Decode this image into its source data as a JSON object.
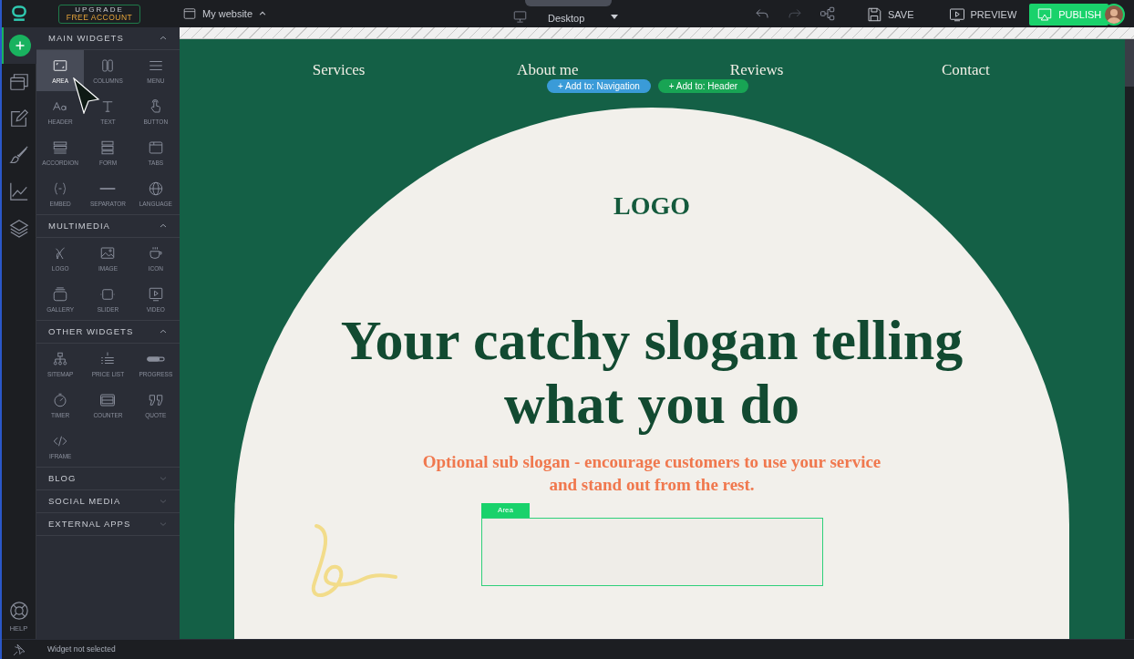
{
  "topbar": {
    "upgrade_top": "UPGRADE",
    "upgrade_bottom": "FREE ACCOUNT",
    "site": "My website",
    "device": "Desktop",
    "buttons": [
      {
        "label": "SAVE",
        "kind": "save"
      },
      {
        "label": "PREVIEW",
        "kind": "preview"
      },
      {
        "label": "PUBLISH",
        "kind": "publish"
      }
    ]
  },
  "rail": {
    "items": [
      {
        "kind": "add",
        "selected": true
      },
      {
        "kind": "pages",
        "selected": false
      },
      {
        "kind": "edit",
        "selected": false
      },
      {
        "kind": "design",
        "selected": false
      },
      {
        "kind": "stats",
        "selected": false
      },
      {
        "kind": "layers",
        "selected": false
      }
    ],
    "help": "HELP"
  },
  "panel": {
    "sections": [
      {
        "title": "MAIN WIDGETS",
        "expanded": true,
        "widgets": [
          {
            "label": "AREA",
            "kind": "area",
            "selected": true
          },
          {
            "label": "COLUMNS",
            "kind": "columns",
            "selected": false
          },
          {
            "label": "MENU",
            "kind": "menu",
            "selected": false
          },
          {
            "label": "HEADER",
            "kind": "header",
            "selected": false
          },
          {
            "label": "TEXT",
            "kind": "text",
            "selected": false
          },
          {
            "label": "BUTTON",
            "kind": "button",
            "selected": false
          },
          {
            "label": "ACCORDION",
            "kind": "accordion",
            "selected": false
          },
          {
            "label": "FORM",
            "kind": "form",
            "selected": false
          },
          {
            "label": "TABS",
            "kind": "tabs",
            "selected": false
          },
          {
            "label": "EMBED",
            "kind": "embed",
            "selected": false
          },
          {
            "label": "SEPARATOR",
            "kind": "separator",
            "selected": false
          },
          {
            "label": "LANGUAGE",
            "kind": "language",
            "selected": false
          }
        ]
      },
      {
        "title": "MULTIMEDIA",
        "expanded": true,
        "widgets": [
          {
            "label": "LOGO",
            "kind": "logo",
            "selected": false
          },
          {
            "label": "IMAGE",
            "kind": "image",
            "selected": false
          },
          {
            "label": "ICON",
            "kind": "icon",
            "selected": false
          },
          {
            "label": "GALLERY",
            "kind": "gallery",
            "selected": false
          },
          {
            "label": "SLIDER",
            "kind": "slider",
            "selected": false
          },
          {
            "label": "VIDEO",
            "kind": "video",
            "selected": false
          }
        ]
      },
      {
        "title": "OTHER WIDGETS",
        "expanded": true,
        "widgets": [
          {
            "label": "SITEMAP",
            "kind": "sitemap",
            "selected": false
          },
          {
            "label": "PRICE LIST",
            "kind": "pricelist",
            "selected": false
          },
          {
            "label": "PROGRESS",
            "kind": "progress",
            "selected": false
          },
          {
            "label": "TIMER",
            "kind": "timer",
            "selected": false
          },
          {
            "label": "COUNTER",
            "kind": "counter",
            "selected": false
          },
          {
            "label": "QUOTE",
            "kind": "quote",
            "selected": false
          },
          {
            "label": "IFRAME",
            "kind": "iframe",
            "selected": false
          }
        ]
      },
      {
        "title": "BLOG",
        "expanded": false
      },
      {
        "title": "SOCIAL MEDIA",
        "expanded": false
      },
      {
        "title": "EXTERNAL APPS",
        "expanded": false
      }
    ]
  },
  "canvas": {
    "nav": [
      "Services",
      "About me",
      "Reviews",
      "Contact"
    ],
    "add_badges": [
      {
        "label": "+ Add to: Navigation",
        "color": "#3a9bd8"
      },
      {
        "label": "+ Add to: Header",
        "color": "#18a454"
      }
    ],
    "logo": "LOGO",
    "slogan": "Your catchy slogan telling what you do",
    "sub_slogan": "Optional sub slogan - encourage customers to use your service and stand out from the rest.",
    "area_label": "Area"
  },
  "status_bar": "Widget not selected"
}
